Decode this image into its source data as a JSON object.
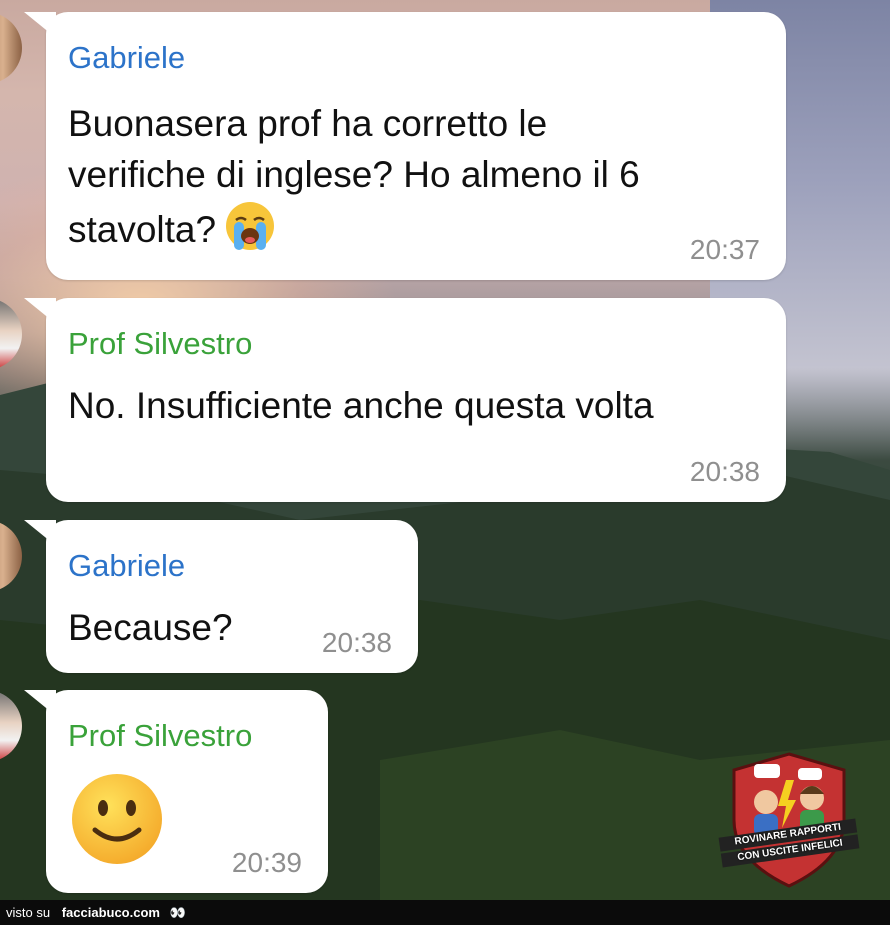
{
  "messages": [
    {
      "sender": "Gabriele",
      "text_lines": [
        "Buonasera prof ha corretto le",
        "verifiche di inglese? Ho almeno il 6",
        "stavolta?"
      ],
      "emoji": "loudly-crying-face",
      "time": "20:37"
    },
    {
      "sender": "Prof Silvestro",
      "text_lines": [
        "No. Insufficiente anche questa volta"
      ],
      "time": "20:38"
    },
    {
      "sender": "Gabriele",
      "text_lines": [
        "Because?"
      ],
      "time": "20:38"
    },
    {
      "sender": "Prof Silvestro",
      "emoji": "slightly-smiling-face",
      "time": "20:39"
    }
  ],
  "watermark": {
    "line1": "ROVINARE RAPPORTI",
    "line2": "CON USCITE INFELICI"
  },
  "footer": {
    "prefix": "visto su",
    "site": "facciabuco.com",
    "eyes": "👀"
  },
  "colors": {
    "gabriele_name": "#2c73c9",
    "prof_name": "#3aa23a",
    "bubble": "#ffffff",
    "timestamp": "#8f8f8f"
  }
}
